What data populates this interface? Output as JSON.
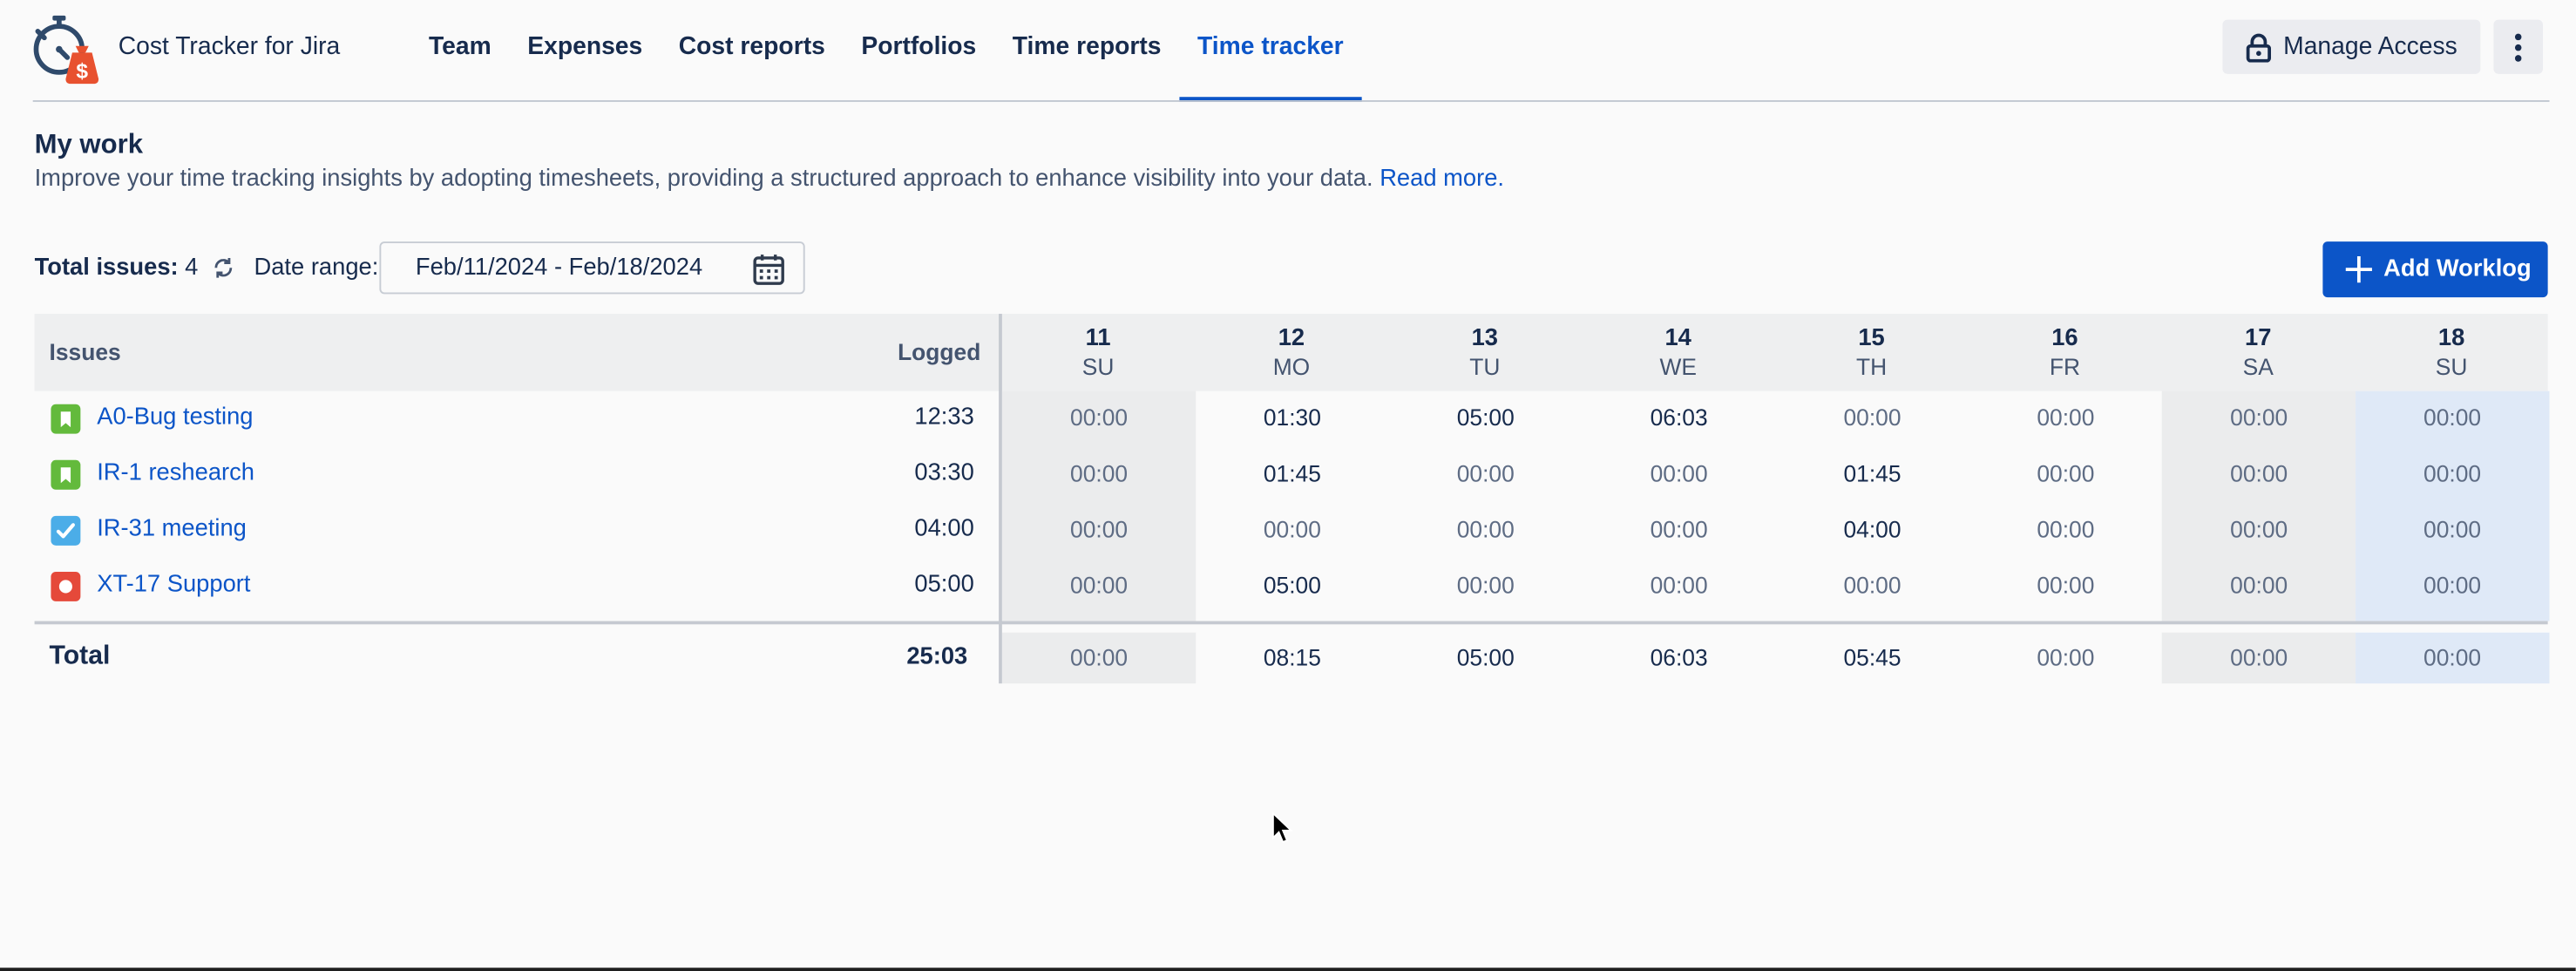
{
  "app": {
    "name": "Cost Tracker for Jira"
  },
  "nav": {
    "tabs": [
      {
        "label": "Team"
      },
      {
        "label": "Expenses"
      },
      {
        "label": "Cost reports"
      },
      {
        "label": "Portfolios"
      },
      {
        "label": "Time reports"
      },
      {
        "label": "Time tracker",
        "active": true
      }
    ]
  },
  "header_actions": {
    "manage_access_label": "Manage Access"
  },
  "page": {
    "title": "My work",
    "description": "Improve your time tracking insights by adopting timesheets, providing a structured approach to enhance visibility into your data.",
    "read_more": "Read more."
  },
  "toolbar": {
    "total_issues_label": "Total issues:",
    "total_issues_count": "4",
    "date_range_label": "Date range:",
    "date_range_value": "Feb/11/2024 - Feb/18/2024",
    "add_worklog_label": "Add Worklog"
  },
  "table": {
    "col_issues": "Issues",
    "col_logged": "Logged",
    "days": [
      {
        "num": "11",
        "dow": "SU"
      },
      {
        "num": "12",
        "dow": "MO"
      },
      {
        "num": "13",
        "dow": "TU"
      },
      {
        "num": "14",
        "dow": "WE"
      },
      {
        "num": "15",
        "dow": "TH"
      },
      {
        "num": "16",
        "dow": "FR"
      },
      {
        "num": "17",
        "dow": "SA"
      },
      {
        "num": "18",
        "dow": "SU"
      }
    ],
    "rows": [
      {
        "issue": "A0-Bug testing",
        "type_icon": "story-icon",
        "logged": "12:33",
        "cells": [
          "00:00",
          "01:30",
          "05:00",
          "06:03",
          "00:00",
          "00:00",
          "00:00",
          "00:00"
        ]
      },
      {
        "issue": "IR-1 reshearch",
        "type_icon": "story-icon",
        "logged": "03:30",
        "cells": [
          "00:00",
          "01:45",
          "00:00",
          "00:00",
          "01:45",
          "00:00",
          "00:00",
          "00:00"
        ]
      },
      {
        "issue": "IR-31 meeting",
        "type_icon": "task-icon",
        "logged": "04:00",
        "cells": [
          "00:00",
          "00:00",
          "00:00",
          "00:00",
          "04:00",
          "00:00",
          "00:00",
          "00:00"
        ]
      },
      {
        "issue": "XT-17 Support",
        "type_icon": "bug-icon",
        "logged": "05:00",
        "cells": [
          "00:00",
          "05:00",
          "00:00",
          "00:00",
          "00:00",
          "00:00",
          "00:00",
          "00:00"
        ]
      }
    ],
    "total": {
      "label": "Total",
      "logged": "25:03",
      "cells": [
        "00:00",
        "08:15",
        "05:00",
        "06:03",
        "05:45",
        "00:00",
        "00:00",
        "00:00"
      ]
    }
  },
  "colors": {
    "accent": "#0c55c8",
    "story": "#63ba3c",
    "task": "#4bade8",
    "bug": "#e5493a",
    "weekend_bg": "#ebeced",
    "today_bg": "#dfe9f7"
  }
}
